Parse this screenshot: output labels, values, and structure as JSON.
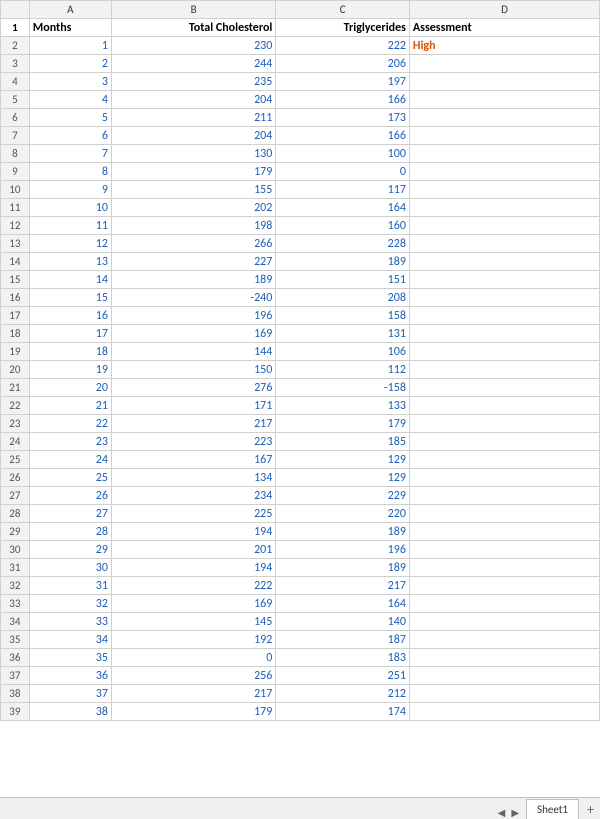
{
  "sheet": {
    "name": "Sheet1",
    "columns": [
      "",
      "A",
      "B",
      "C",
      "D"
    ],
    "headers": {
      "a": "Months",
      "b": "Total Cholesterol",
      "c": "Triglycerides",
      "d": "Assessment"
    },
    "assessment_high": "High",
    "rows": [
      {
        "num": 2,
        "a": "1",
        "b": "230",
        "c": "222",
        "d": "High"
      },
      {
        "num": 3,
        "a": "2",
        "b": "244",
        "c": "206",
        "d": ""
      },
      {
        "num": 4,
        "a": "3",
        "b": "235",
        "c": "197",
        "d": ""
      },
      {
        "num": 5,
        "a": "4",
        "b": "204",
        "c": "166",
        "d": ""
      },
      {
        "num": 6,
        "a": "5",
        "b": "211",
        "c": "173",
        "d": ""
      },
      {
        "num": 7,
        "a": "6",
        "b": "204",
        "c": "166",
        "d": ""
      },
      {
        "num": 8,
        "a": "7",
        "b": "130",
        "c": "100",
        "d": ""
      },
      {
        "num": 9,
        "a": "8",
        "b": "179",
        "c": "0",
        "d": ""
      },
      {
        "num": 10,
        "a": "9",
        "b": "155",
        "c": "117",
        "d": ""
      },
      {
        "num": 11,
        "a": "10",
        "b": "202",
        "c": "164",
        "d": ""
      },
      {
        "num": 12,
        "a": "11",
        "b": "198",
        "c": "160",
        "d": ""
      },
      {
        "num": 13,
        "a": "12",
        "b": "266",
        "c": "228",
        "d": ""
      },
      {
        "num": 14,
        "a": "13",
        "b": "227",
        "c": "189",
        "d": ""
      },
      {
        "num": 15,
        "a": "14",
        "b": "189",
        "c": "151",
        "d": ""
      },
      {
        "num": 16,
        "a": "15",
        "b": "-240",
        "c": "208",
        "d": ""
      },
      {
        "num": 17,
        "a": "16",
        "b": "196",
        "c": "158",
        "d": ""
      },
      {
        "num": 18,
        "a": "17",
        "b": "169",
        "c": "131",
        "d": ""
      },
      {
        "num": 19,
        "a": "18",
        "b": "144",
        "c": "106",
        "d": ""
      },
      {
        "num": 20,
        "a": "19",
        "b": "150",
        "c": "112",
        "d": ""
      },
      {
        "num": 21,
        "a": "20",
        "b": "276",
        "c": "-158",
        "d": ""
      },
      {
        "num": 22,
        "a": "21",
        "b": "171",
        "c": "133",
        "d": ""
      },
      {
        "num": 23,
        "a": "22",
        "b": "217",
        "c": "179",
        "d": ""
      },
      {
        "num": 24,
        "a": "23",
        "b": "223",
        "c": "185",
        "d": ""
      },
      {
        "num": 25,
        "a": "24",
        "b": "167",
        "c": "129",
        "d": ""
      },
      {
        "num": 26,
        "a": "25",
        "b": "134",
        "c": "129",
        "d": ""
      },
      {
        "num": 27,
        "a": "26",
        "b": "234",
        "c": "229",
        "d": ""
      },
      {
        "num": 28,
        "a": "27",
        "b": "225",
        "c": "220",
        "d": ""
      },
      {
        "num": 29,
        "a": "28",
        "b": "194",
        "c": "189",
        "d": ""
      },
      {
        "num": 30,
        "a": "29",
        "b": "201",
        "c": "196",
        "d": ""
      },
      {
        "num": 31,
        "a": "30",
        "b": "194",
        "c": "189",
        "d": ""
      },
      {
        "num": 32,
        "a": "31",
        "b": "222",
        "c": "217",
        "d": ""
      },
      {
        "num": 33,
        "a": "32",
        "b": "169",
        "c": "164",
        "d": ""
      },
      {
        "num": 34,
        "a": "33",
        "b": "145",
        "c": "140",
        "d": ""
      },
      {
        "num": 35,
        "a": "34",
        "b": "192",
        "c": "187",
        "d": ""
      },
      {
        "num": 36,
        "a": "35",
        "b": "0",
        "c": "183",
        "d": ""
      },
      {
        "num": 37,
        "a": "36",
        "b": "256",
        "c": "251",
        "d": ""
      },
      {
        "num": 38,
        "a": "37",
        "b": "217",
        "c": "212",
        "d": ""
      },
      {
        "num": 39,
        "a": "38",
        "b": "179",
        "c": "174",
        "d": ""
      }
    ],
    "tab_label": "Sheet1",
    "add_tab_icon": "+"
  }
}
